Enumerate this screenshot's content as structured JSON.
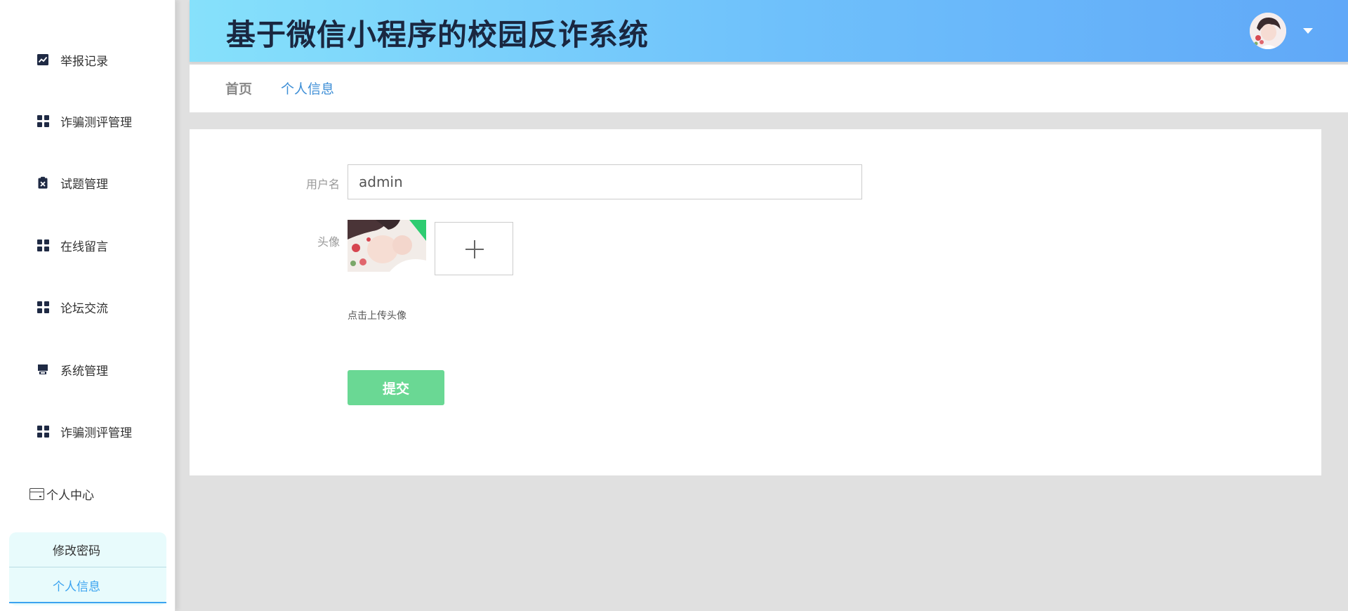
{
  "app": {
    "title": "基于微信小程序的校园反诈系统"
  },
  "sidebar": {
    "items": [
      {
        "label": "举报记录",
        "icon": "trend-chart-icon"
      },
      {
        "label": "诈骗测评管理",
        "icon": "grid-icon"
      },
      {
        "label": "试题管理",
        "icon": "clipboard-x-icon"
      },
      {
        "label": "在线留言",
        "icon": "grid-icon"
      },
      {
        "label": "论坛交流",
        "icon": "grid-icon"
      },
      {
        "label": "系统管理",
        "icon": "store-icon"
      },
      {
        "label": "诈骗测评管理",
        "icon": "grid-icon"
      }
    ],
    "user_center": {
      "label": "个人中心",
      "icon": "wallet-icon"
    },
    "submenu": [
      {
        "label": "修改密码"
      },
      {
        "label": "个人信息",
        "active": true
      }
    ]
  },
  "breadcrumb": {
    "home": "首页",
    "current": "个人信息"
  },
  "form": {
    "username_label": "用户名",
    "username_value": "admin",
    "avatar_label": "头像",
    "upload_hint": "点击上传头像",
    "submit_label": "提交"
  },
  "colors": {
    "header_gradient_start": "#86e1fb",
    "header_gradient_end": "#60a8f8",
    "active_link": "#3ba3f0",
    "submit_button": "#6ad894",
    "submenu_bg": "#e8fbfc"
  }
}
